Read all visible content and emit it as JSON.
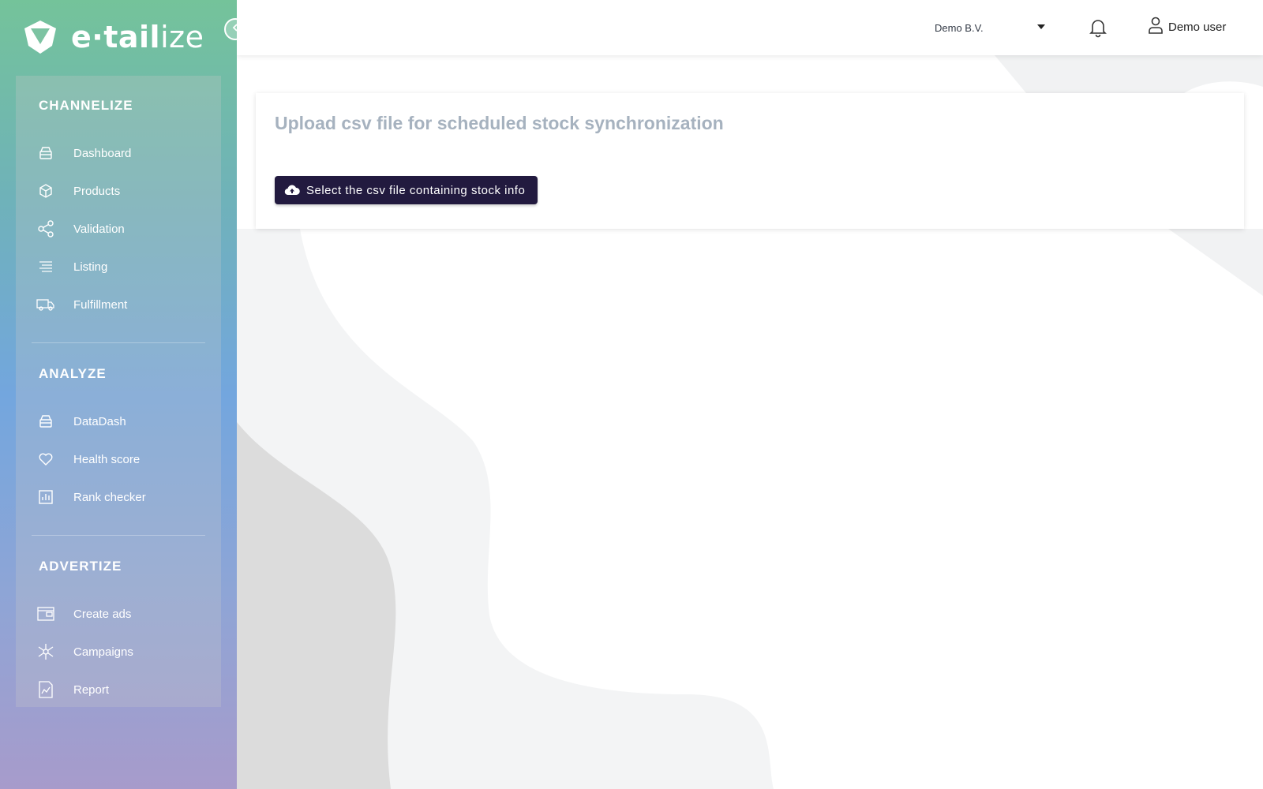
{
  "brand": {
    "logo_prefix": "e·tail",
    "logo_suffix": "ize",
    "logo_icon": "etailize-logo-icon"
  },
  "sidebar": {
    "collapse_icon": "chevron-left-icon",
    "sections": [
      {
        "title": "CHANNELIZE",
        "items": [
          {
            "label": "Dashboard",
            "icon": "dashboard-icon"
          },
          {
            "label": "Products",
            "icon": "box-icon"
          },
          {
            "label": "Validation",
            "icon": "share-nodes-icon"
          },
          {
            "label": "Listing",
            "icon": "list-icon"
          },
          {
            "label": "Fulfillment",
            "icon": "truck-icon"
          }
        ]
      },
      {
        "title": "ANALYZE",
        "items": [
          {
            "label": "DataDash",
            "icon": "dashboard-icon"
          },
          {
            "label": "Health score",
            "icon": "heart-icon"
          },
          {
            "label": "Rank checker",
            "icon": "bar-chart-icon"
          }
        ]
      },
      {
        "title": "ADVERTIZE",
        "items": [
          {
            "label": "Create ads",
            "icon": "ads-icon"
          },
          {
            "label": "Campaigns",
            "icon": "network-icon"
          },
          {
            "label": "Report",
            "icon": "report-icon"
          }
        ]
      }
    ]
  },
  "header": {
    "company": "Demo B.V.",
    "notification_icon": "bell-icon",
    "user_icon": "user-icon",
    "user_name": "Demo user"
  },
  "main": {
    "card_title": "Upload csv file for scheduled stock synchronization",
    "upload_button_label": "Select the csv file containing stock info",
    "upload_icon": "cloud-upload-icon"
  },
  "colors": {
    "primary_button": "#221a3f",
    "card_title": "#a6b2bf",
    "sidebar_gradient_top": "#74c39a",
    "sidebar_gradient_bottom": "#a79bcb"
  }
}
